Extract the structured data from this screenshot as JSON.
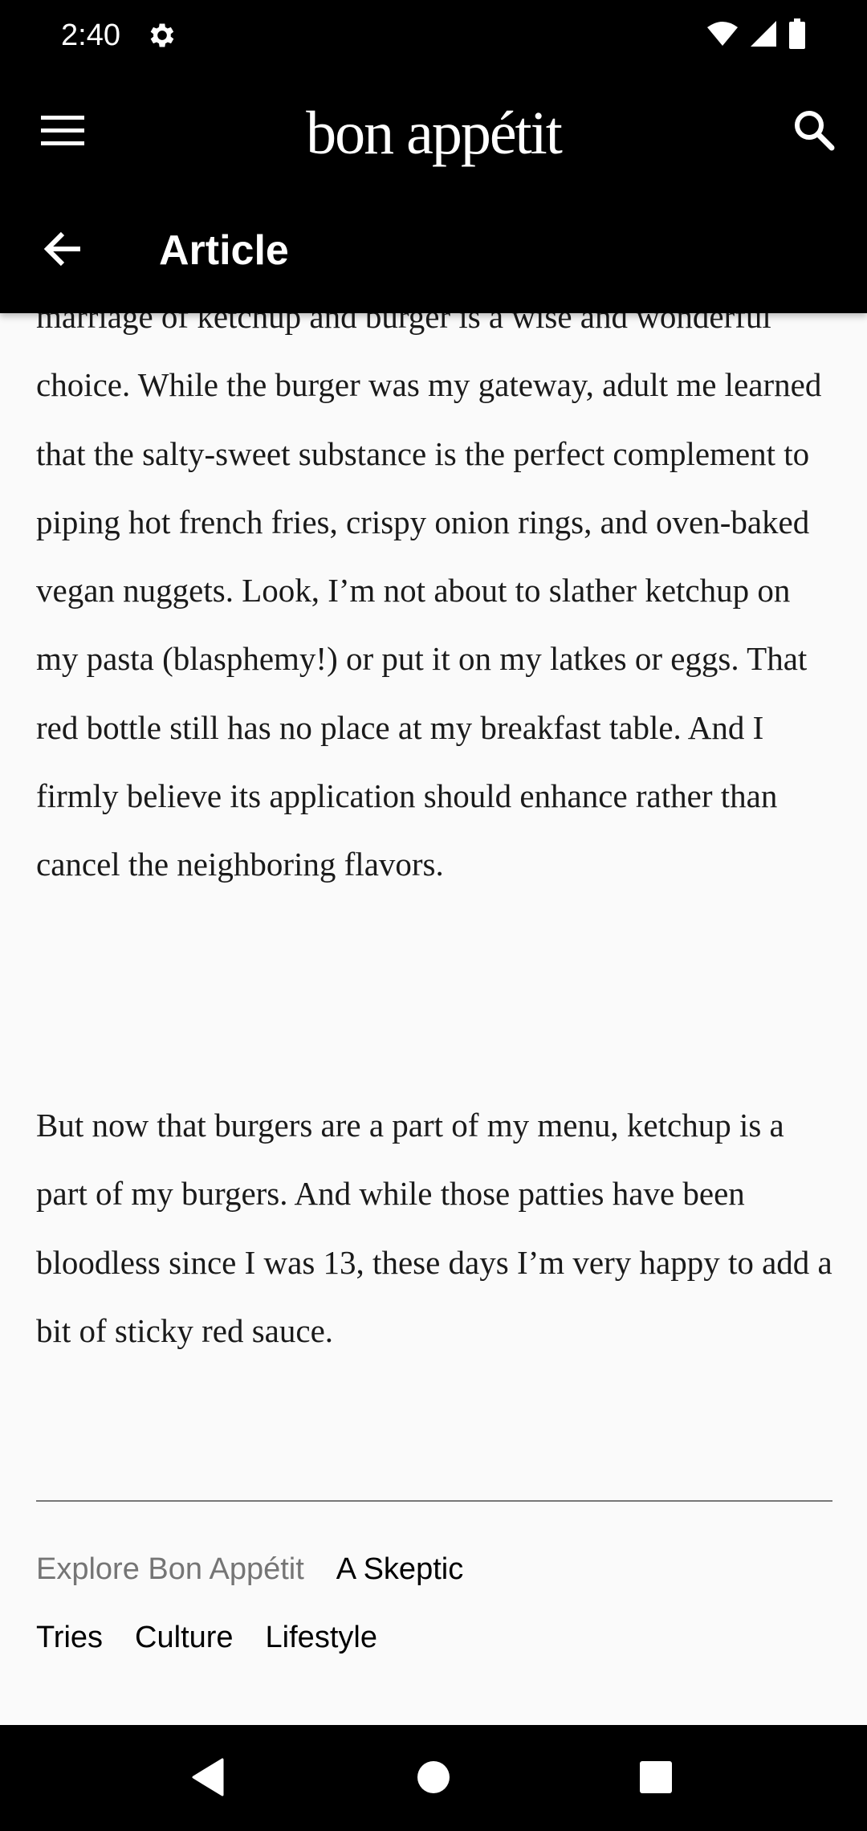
{
  "status_bar": {
    "time": "2:40",
    "icons": [
      "gear-icon",
      "wifi-icon",
      "signal-icon",
      "battery-icon"
    ]
  },
  "header": {
    "brand": "bon appétit",
    "screen_title": "Article",
    "icons": [
      "menu-icon",
      "search-icon",
      "back-arrow-icon"
    ]
  },
  "article": {
    "paragraphs": [
      "marriage of ketchup and burger is a wise and wonderful choice. While the burger was my gateway, adult me learned that the salty-sweet substance is the perfect complement to piping hot french fries, crispy onion rings, and oven-baked vegan nuggets. Look, I’m not about to slather ketchup on my pasta (blasphemy!) or put it on my latkes or eggs. That red bottle still has no place at my breakfast table. And I firmly believe its application should enhance rather than cancel the neighboring flavors.",
      "But now that burgers are a part of my menu, ketchup is a part of my burgers. And while those patties have been bloodless since I was 13, these days I’m very happy to add a bit of sticky red sauce."
    ]
  },
  "explore": {
    "label": "Explore Bon Appétit",
    "links": [
      "A Skeptic Tries",
      "Culture",
      "Lifestyle"
    ]
  },
  "nav_bar": {
    "icons": [
      "nav-back-icon",
      "nav-home-icon",
      "nav-recents-icon"
    ]
  },
  "colors": {
    "bar_background": "#000000",
    "page_background": "#fafafa",
    "text": "#1a1a1a",
    "muted": "#757575"
  }
}
